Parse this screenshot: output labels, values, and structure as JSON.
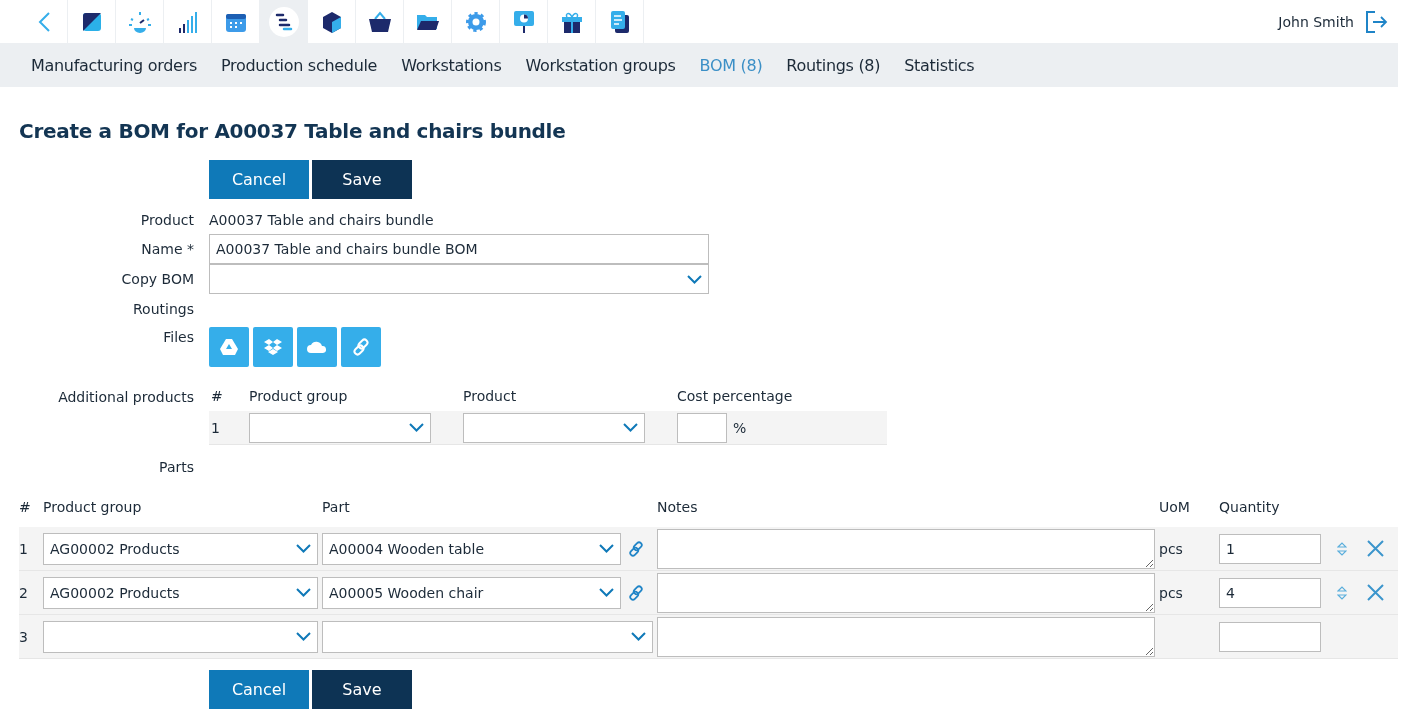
{
  "toolbar": {
    "apps": [
      {
        "kind": "square",
        "selected": false
      },
      {
        "kind": "gauge",
        "selected": false
      },
      {
        "kind": "bars",
        "selected": false
      },
      {
        "kind": "calendar",
        "selected": false
      },
      {
        "kind": "schedule",
        "selected": true
      },
      {
        "kind": "cube",
        "selected": false
      },
      {
        "kind": "basket",
        "selected": false
      },
      {
        "kind": "folder",
        "selected": false
      },
      {
        "kind": "gear",
        "selected": false
      },
      {
        "kind": "presentation",
        "selected": false
      },
      {
        "kind": "gift",
        "selected": false
      },
      {
        "kind": "document",
        "selected": false
      }
    ],
    "user": "John Smith"
  },
  "subnav": [
    {
      "label": "Manufacturing orders",
      "selected": false
    },
    {
      "label": "Production schedule",
      "selected": false
    },
    {
      "label": "Workstations",
      "selected": false
    },
    {
      "label": "Workstation groups",
      "selected": false
    },
    {
      "label": "BOM (8)",
      "selected": true
    },
    {
      "label": "Routings (8)",
      "selected": false
    },
    {
      "label": "Statistics",
      "selected": false
    }
  ],
  "title": "Create a BOM for A00037 Table and chairs bundle",
  "top_buttons": {
    "cancel": "Cancel",
    "save": "Save"
  },
  "form": {
    "product_label": "Product",
    "product": "A00037 Table and chairs bundle",
    "name_label": "Name *",
    "name": "A00037 Table and chairs bundle BOM",
    "copy_label": "Copy BOM",
    "routings_label": "Routings",
    "files_label": "Files",
    "files": [
      {
        "kind": "drive"
      },
      {
        "kind": "dropbox"
      },
      {
        "kind": "cloud"
      },
      {
        "kind": "link"
      }
    ]
  },
  "additional": {
    "label": "Additional products",
    "columns": [
      "#",
      "Product group",
      "Product",
      "Cost percentage"
    ],
    "rows": [
      {
        "number": "1",
        "unit": "%"
      }
    ]
  },
  "parts": {
    "label": "Parts",
    "columns": [
      "#",
      "Product group",
      "Part",
      "Notes",
      "UoM",
      "Quantity"
    ],
    "rows": [
      {
        "number": "1",
        "product_group": "AG00002 Products",
        "part": "A00004 Wooden table",
        "uom": "pcs",
        "quantity": "1",
        "removable": true
      },
      {
        "number": "2",
        "product_group": "AG00002 Products",
        "part": "A00005 Wooden chair",
        "uom": "pcs",
        "quantity": "4",
        "removable": true
      },
      {
        "number": "3",
        "removable": false
      }
    ]
  },
  "bottom_buttons": {
    "cancel": "Cancel",
    "save": "Save"
  }
}
